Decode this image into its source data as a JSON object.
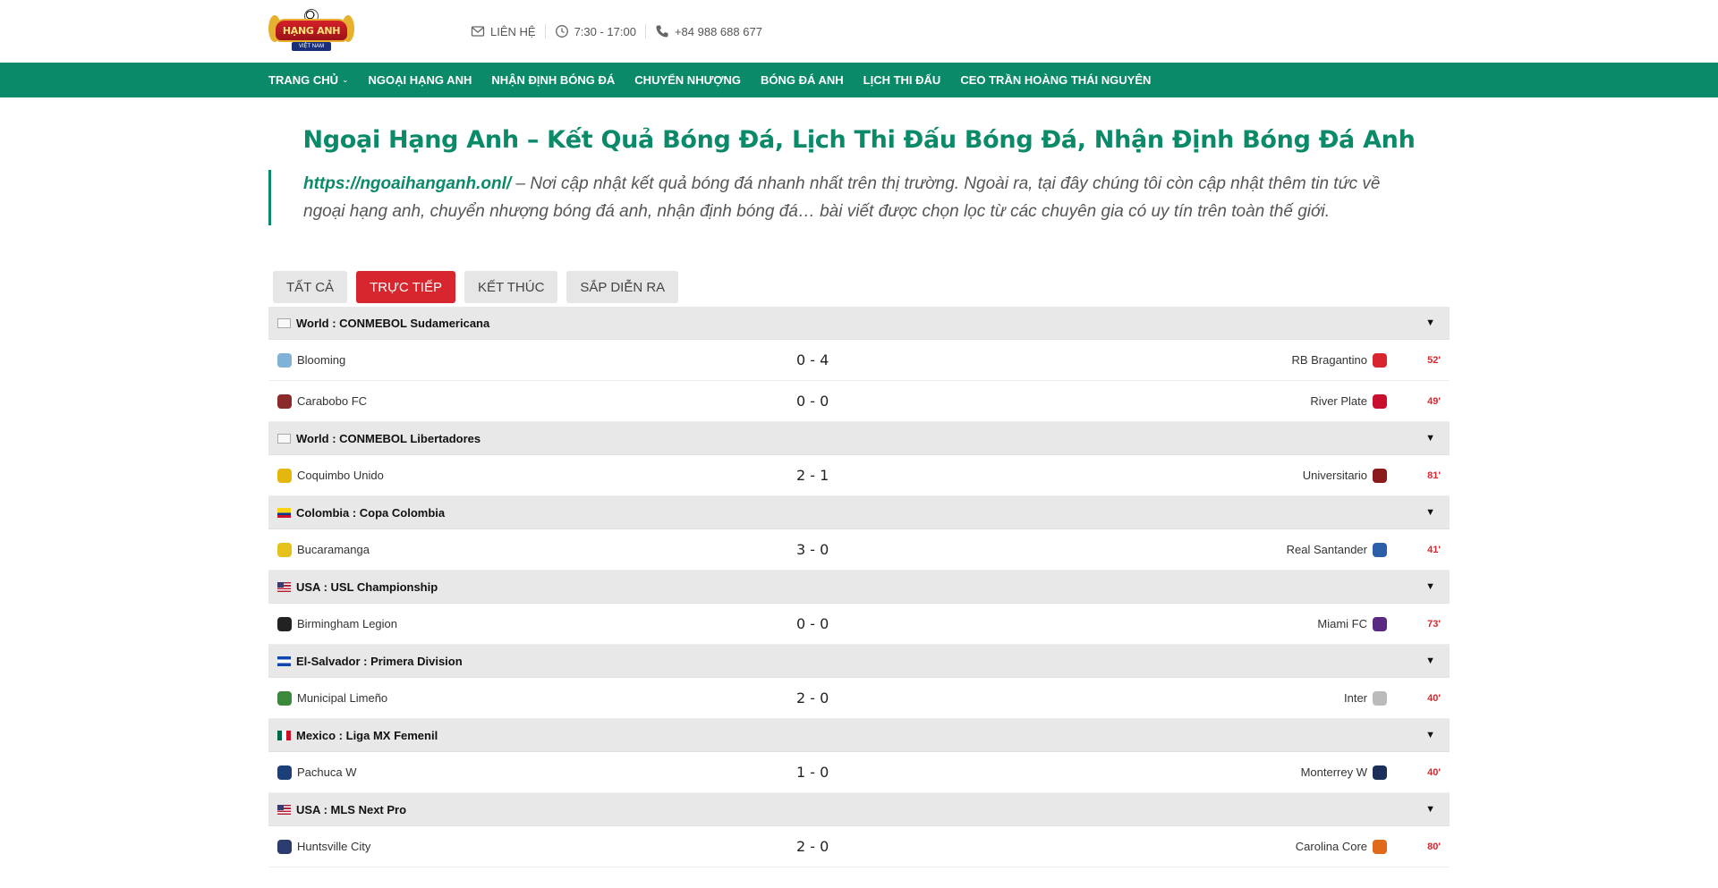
{
  "logo": {
    "line1": "NGOẠI",
    "line2": "HẠNG ANH",
    "sub": "VIỆT NAM"
  },
  "contact": {
    "email_label": "LIÊN HỆ",
    "hours": "7:30 - 17:00",
    "phone": "+84 988 688 677"
  },
  "nav": {
    "items": [
      {
        "label": "TRANG CHỦ"
      },
      {
        "label": "NGOẠI HẠNG ANH"
      },
      {
        "label": "NHẬN ĐỊNH BÓNG ĐÁ"
      },
      {
        "label": "CHUYỂN NHƯỢNG"
      },
      {
        "label": "BÓNG ĐÁ ANH"
      },
      {
        "label": "LỊCH THI ĐẤU"
      },
      {
        "label": "CEO TRẦN HOÀNG THÁI NGUYÊN"
      }
    ]
  },
  "page": {
    "title": "Ngoại Hạng Anh – Kết Quả Bóng Đá, Lịch Thi Đấu Bóng Đá, Nhận Định Bóng Đá Anh",
    "intro_link": "https://ngoaihanganh.onl/",
    "intro_text": " – Nơi cập nhật kết quả bóng đá nhanh nhất trên thị trường. Ngoài ra, tại đây chúng tôi còn cập nhật thêm tin tức về ngoại hạng anh, chuyển nhượng bóng đá anh, nhận định bóng đá… bài viết được chọn lọc từ các chuyên gia có uy tín trên toàn thế giới."
  },
  "tabs": [
    {
      "label": "TẤT CẢ",
      "active": false
    },
    {
      "label": "TRỰC TIẾP",
      "active": true
    },
    {
      "label": "KẾT THÚC",
      "active": false
    },
    {
      "label": "SẮP DIỄN RA",
      "active": false
    }
  ],
  "collapse_arrow": "▼",
  "leagues": [
    {
      "name": "World : CONMEBOL Sudamericana",
      "flag": "broken",
      "matches": [
        {
          "home": "Blooming",
          "score": "0 - 4",
          "away": "RB Bragantino",
          "minute": "52'",
          "home_color": "#7fb2d6",
          "away_color": "#d7262d"
        },
        {
          "home": "Carabobo FC",
          "score": "0 - 0",
          "away": "River Plate",
          "minute": "49'",
          "home_color": "#8b2a2a",
          "away_color": "#c8102e"
        }
      ]
    },
    {
      "name": "World : CONMEBOL Libertadores",
      "flag": "broken",
      "matches": [
        {
          "home": "Coquimbo Unido",
          "score": "2 - 1",
          "away": "Universitario",
          "minute": "81'",
          "home_color": "#e2b80f",
          "away_color": "#8b1a1a"
        }
      ]
    },
    {
      "name": "Colombia : Copa Colombia",
      "flag": "colombia",
      "matches": [
        {
          "home": "Bucaramanga",
          "score": "3 - 0",
          "away": "Real Santander",
          "minute": "41'",
          "home_color": "#e5c21b",
          "away_color": "#2b5fa8"
        }
      ]
    },
    {
      "name": "USA : USL Championship",
      "flag": "usa",
      "matches": [
        {
          "home": "Birmingham Legion",
          "score": "0 - 0",
          "away": "Miami FC",
          "minute": "73'",
          "home_color": "#222222",
          "away_color": "#5a2a82"
        }
      ]
    },
    {
      "name": "El-Salvador : Primera Division",
      "flag": "elsalvador",
      "matches": [
        {
          "home": "Municipal Limeño",
          "score": "2 - 0",
          "away": "Inter",
          "minute": "40'",
          "home_color": "#3b8a3b",
          "away_color": "#bbbbbb"
        }
      ]
    },
    {
      "name": "Mexico : Liga MX Femenil",
      "flag": "mexico",
      "matches": [
        {
          "home": "Pachuca W",
          "score": "1 - 0",
          "away": "Monterrey W",
          "minute": "40'",
          "home_color": "#1c3f7a",
          "away_color": "#1c2f5a"
        }
      ]
    },
    {
      "name": "USA : MLS Next Pro",
      "flag": "usa",
      "matches": [
        {
          "home": "Huntsville City",
          "score": "2 - 0",
          "away": "Carolina Core",
          "minute": "80'",
          "home_color": "#2a3d6e",
          "away_color": "#e06a1b"
        }
      ]
    }
  ]
}
